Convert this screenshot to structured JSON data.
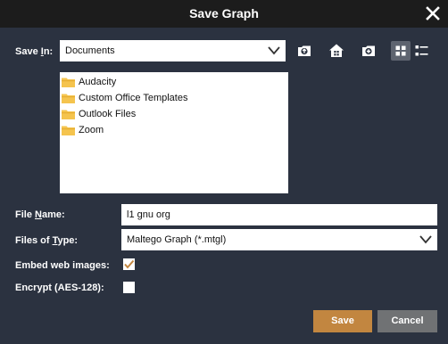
{
  "window": {
    "title": "Save Graph"
  },
  "save_in": {
    "label_before": "Save ",
    "label_mnemonic": "I",
    "label_after": "n:",
    "selected": "Documents"
  },
  "toolbar": {
    "icons": [
      "up-folder-icon",
      "home-icon",
      "new-folder-icon",
      "grid-view-icon",
      "list-view-icon"
    ]
  },
  "files": [
    {
      "name": "Audacity",
      "icon": "folder-icon"
    },
    {
      "name": "Custom Office Templates",
      "icon": "folder-icon"
    },
    {
      "name": "Outlook Files",
      "icon": "folder-icon"
    },
    {
      "name": "Zoom",
      "icon": "folder-icon"
    }
  ],
  "file_name": {
    "label_before": "File ",
    "label_mnemonic": "N",
    "label_after": "ame:",
    "value": "l1 gnu org"
  },
  "files_of_type": {
    "label_before": "Files of ",
    "label_mnemonic": "T",
    "label_after": "ype:",
    "selected": "Maltego Graph (*.mtgl)"
  },
  "embed_web_images": {
    "label": "Embed web images:",
    "checked": true
  },
  "encrypt": {
    "label": "Encrypt (AES-128):",
    "checked": false
  },
  "buttons": {
    "save_label": "Save",
    "cancel_label": "Cancel"
  },
  "colors": {
    "background": "#2b3240",
    "titlebar": "#1c1c1c",
    "accent": "#c28640",
    "folder": "#f5c44e"
  }
}
